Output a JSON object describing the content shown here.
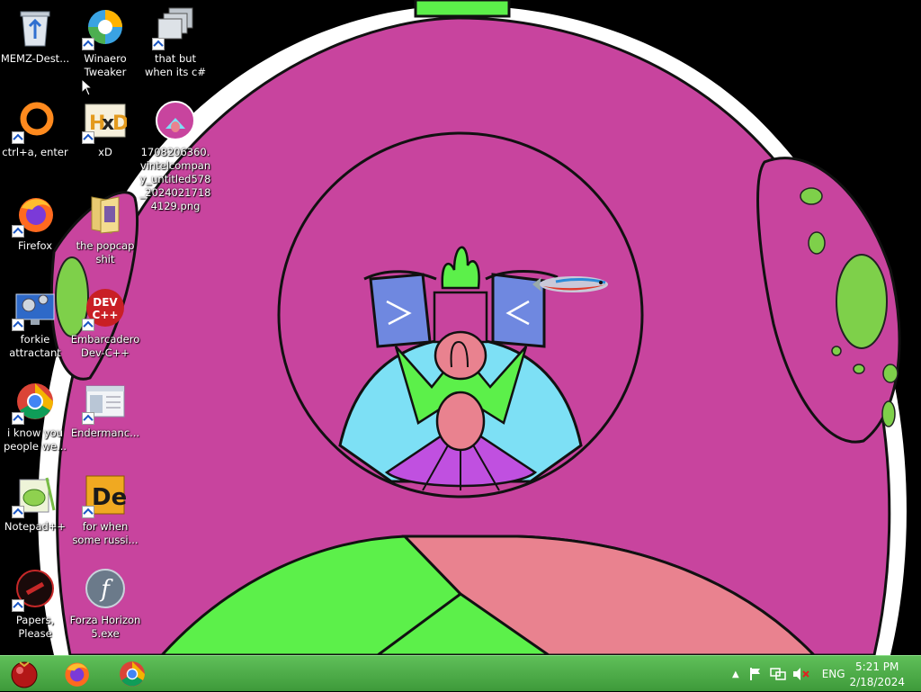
{
  "desktop": {
    "icons": [
      {
        "label": "MEMZ-Dest...",
        "icon": "recycle-bin-icon"
      },
      {
        "label": "Winaero Tweaker",
        "icon": "winaero-icon"
      },
      {
        "label": "that but when its c#",
        "icon": "windows-stack-icon"
      },
      {
        "label": "ctrl+a, enter",
        "icon": "ring-icon"
      },
      {
        "label": "xD",
        "icon": "hxd-icon"
      },
      {
        "label": "1708206360.vintelcompany_untitled578_20240217184129.png",
        "icon": "image-file-icon"
      },
      {
        "label": "Firefox",
        "icon": "firefox-icon"
      },
      {
        "label": "the popcap shit",
        "icon": "folder-icon"
      },
      {
        "label": "forkie attractant",
        "icon": "settings-monitor-icon"
      },
      {
        "label": "Embarcadero Dev-C++",
        "icon": "devcpp-icon"
      },
      {
        "label": "i know you people we...",
        "icon": "chrome-icon"
      },
      {
        "label": "Endermanc...",
        "icon": "window-app-icon"
      },
      {
        "label": "Notepad++",
        "icon": "notepadpp-icon"
      },
      {
        "label": "for when some russi...",
        "icon": "de-icon"
      },
      {
        "label": "Papers, Please",
        "icon": "papers-please-icon"
      },
      {
        "label": "Forza Horizon 5.exe",
        "icon": "flash-icon"
      }
    ]
  },
  "taskbar": {
    "start_icon": "start-orb-icon",
    "pinned": [
      {
        "name": "firefox",
        "icon": "firefox-icon"
      },
      {
        "name": "chrome",
        "icon": "chrome-icon"
      }
    ],
    "tray": {
      "language": "ENG",
      "time": "5:21 PM",
      "date": "2/18/2024"
    }
  },
  "colors": {
    "taskbar": "#4caf48",
    "wallpaper_magenta": "#c8449e",
    "wallpaper_green": "#5cf04a",
    "wallpaper_pink": "#e9828f",
    "wallpaper_cyan": "#7de0f5"
  }
}
